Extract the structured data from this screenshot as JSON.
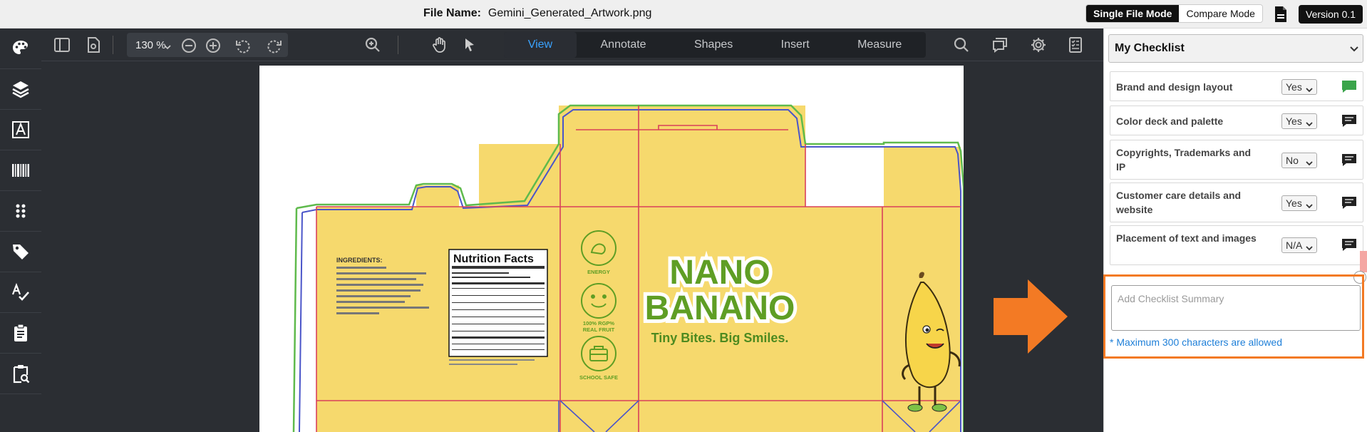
{
  "header": {
    "file_label": "File Name:",
    "file_name": "Gemini_Generated_Artwork.png",
    "mode_single": "Single File Mode",
    "mode_compare": "Compare Mode",
    "version": "Version 0.1"
  },
  "left_rail": {
    "items": [
      "palette-icon",
      "layers-icon",
      "text-icon",
      "barcode-icon",
      "grid-dots-icon",
      "tag-icon",
      "spellcheck-icon",
      "clipboard-icon",
      "clipboard-search-icon"
    ]
  },
  "toolbar": {
    "zoom": "130 %",
    "tabs": [
      "View",
      "Annotate",
      "Shapes",
      "Insert",
      "Measure"
    ],
    "active_tab": "View",
    "accent_color": "#3aa3ff"
  },
  "artwork": {
    "panel_labels": {
      "ingredients_heading": "INGREDIENTS:",
      "nutrition_title": "Nutrition Facts",
      "icon_energy": "ENERGY",
      "icon_fruit_line1": "100% RGP%",
      "icon_fruit_line2": "REAL FRUIT",
      "icon_school": "SCHOOL SAFE",
      "brand_line1": "NANO",
      "brand_line2": "BANANO",
      "tagline": "Tiny Bites. Big Smiles."
    },
    "colors": {
      "box_fill": "#f6d96d",
      "outline_blue": "#4a55c9",
      "outline_green": "#5fba4c",
      "fold_red": "#d9405b",
      "brand_green": "#5f9e24"
    }
  },
  "checklist": {
    "title": "My Checklist",
    "items": [
      {
        "label": "Brand and design layout",
        "value": "Yes",
        "comment_color": "#3aa44a"
      },
      {
        "label": "Color deck and palette",
        "value": "Yes",
        "comment_color": "#222222"
      },
      {
        "label": "Copyrights, Trademarks and IP",
        "value": "No",
        "comment_color": "#222222"
      },
      {
        "label": "Customer care details and website",
        "value": "Yes",
        "comment_color": "#222222"
      },
      {
        "label": "Placement of text and images",
        "value": "N/A",
        "comment_color": "#222222"
      }
    ],
    "summary_placeholder": "Add Checklist Summary",
    "summary_note": "* Maximum 300 characters are allowed",
    "highlight_color": "#f37a24"
  }
}
